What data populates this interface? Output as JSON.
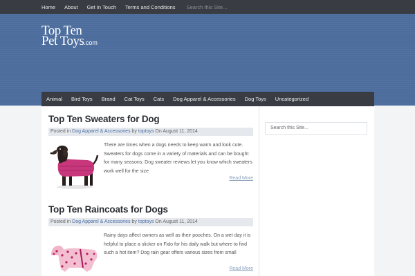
{
  "top_nav": {
    "items": [
      "Home",
      "About",
      "Get In Touch",
      "Terms and Conditions"
    ],
    "search_placeholder": "Search this Site..."
  },
  "logo": {
    "line1": "Top Ten",
    "line2": "Pet Toys",
    "suffix": ".com"
  },
  "category_nav": {
    "items": [
      "Animal",
      "Bird Toys",
      "Brand",
      "Cat Toys",
      "Cats",
      "Dog Apparel & Accessories",
      "Dog Toys",
      "Uncategorized"
    ]
  },
  "posts": [
    {
      "title": "Top Ten Sweaters for Dog",
      "meta_prefix": "Posted in",
      "category": "Dog Apparel & Accessories",
      "meta_by": "by",
      "author": "toptoys",
      "meta_on": "On",
      "date": "August 11, 2014",
      "excerpt": "There are times when a dogs needs to keep warm and look cute. Sweaters for dogs come in a variety of materials and can be bought for many seasons. Dog sweater reviews let you know which sweaters work well for the size",
      "read_more": "Read More",
      "image": "dog-in-pink-sweater"
    },
    {
      "title": "Top Ten Raincoats for Dogs",
      "meta_prefix": "Posted in",
      "category": "Dog Apparel & Accessories",
      "meta_by": "by",
      "author": "toptoys",
      "meta_on": "On",
      "date": "August 11, 2014",
      "excerpt": "Rainy days affect owners as well as their pooches. On a wet day it is helpful to place a slicker on Fido for his daily walk but where to find such a hot item? Dog rain gear offers various sizes from small",
      "read_more": "Read More",
      "image": "pink-polka-dot-raincoat"
    }
  ],
  "sidebar": {
    "search_placeholder": "Search this Site..."
  },
  "colors": {
    "topbar": "#393c42",
    "header": "#4c6d9d",
    "link": "#4a6fa5",
    "meta_bg": "#e5e8ed"
  }
}
